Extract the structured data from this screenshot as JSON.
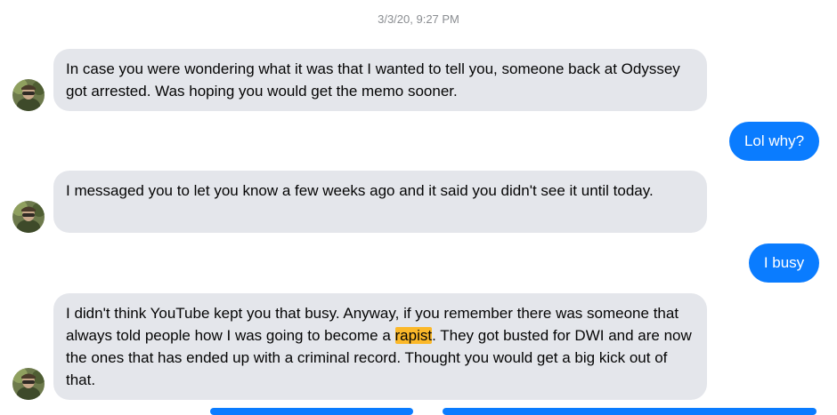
{
  "conversation": {
    "timestamp": "3/3/20, 9:27 PM",
    "messages": [
      {
        "sender": "contact",
        "text": "In case you were wondering what it was that I wanted to tell you, someone back at Odyssey got arrested. Was hoping you would get the memo sooner."
      },
      {
        "sender": "me",
        "text": "Lol why?"
      },
      {
        "sender": "contact",
        "text": "I messaged you to let you know a few weeks ago and it said you didn't see it until today."
      },
      {
        "sender": "me",
        "text": "I busy"
      },
      {
        "sender": "contact",
        "text_before": "I didn't think YouTube kept you that  busy. Anyway, if you remember there was someone that always told people how I was going to become a ",
        "highlight": "rapist",
        "text_after": ". They got busted for DWI and are now the ones that has ended up with a criminal record. Thought you would get a big kick out of that."
      }
    ]
  },
  "colors": {
    "incoming_bubble": "#e4e6eb",
    "outgoing_bubble": "#0a7cff",
    "highlight": "#fbb829",
    "timestamp": "#8a8d91"
  },
  "icons": {
    "avatar": "contact-avatar-photo"
  }
}
